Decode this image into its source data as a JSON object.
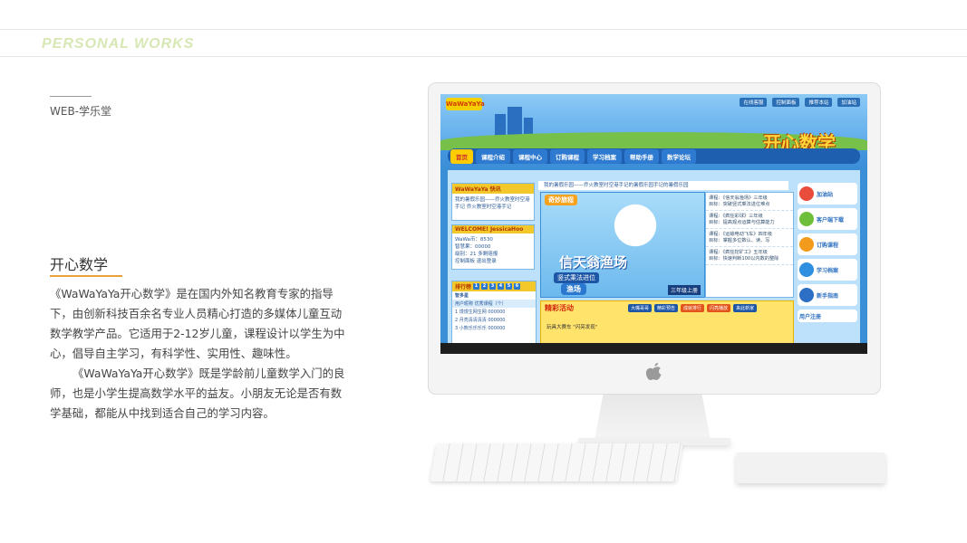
{
  "header": {
    "brand": "PERSONAL WORKS"
  },
  "section": {
    "label": "WEB-学乐堂"
  },
  "project": {
    "title": "开心数学",
    "paragraph1": "《WaWaYaYa开心数学》是在国内外知名教育专家的指导下，由创新科技百余名专业人员精心打造的多媒体儿童互动数学教学产品。它适用于2-12岁儿童，课程设计以学生为中心，倡导自主学习，有科学性、实用性、趣味性。",
    "paragraph2": "《WaWaYaYa开心数学》既是学龄前儿童数学入门的良师，也是小学生提高数学水平的益友。小朋友无论是否有数学基础，都能从中找到适合自己的学习内容。"
  },
  "screen": {
    "logo": "WaWaYaYa",
    "toplinks": [
      "在线客服",
      "控制面板",
      "推荐本站",
      "加油站"
    ],
    "site_title": "开心数学",
    "nav": [
      "首页",
      "课程介绍",
      "课程中心",
      "订购课程",
      "学习档案",
      "帮助手册",
      "数学论坛"
    ],
    "notice": "我的暑假乐园——乔火教室时空港手记的暑假乐园手记的暑假乐园",
    "news_head": "WaWaYaYa 快讯",
    "news_text": "我的暑假乐园——乔火教室时空港手记 乔火教室时空港手记",
    "welcome_head": "WELCOME! JessicaHoo",
    "welcome_lines": [
      "WaWa币：8530",
      "智慧果：00000",
      "级别：21 多剩赔报",
      "控制面板  退出登录"
    ],
    "feature_tag": "奇妙旅程",
    "feature_title": "信天翁渔场",
    "feature_sub": "竖式乘法进位",
    "feature_sub2": "渔场",
    "feature_badge": "三年级上册",
    "courses": [
      {
        "name": "课程：《信天翁渔场》三年级",
        "goal": "目标：突破竖式乘法进位难点"
      },
      {
        "name": "课程：《疯狂彩球》三年级",
        "goal": "目标：提高观点运算与估算能力"
      },
      {
        "name": "课程：《运输电动飞车》四年级",
        "goal": "目标：掌握多位数认、读、写"
      },
      {
        "name": "课程：《疯狂挖矿工》五年级",
        "goal": "目标：快速判断100以内数的整除"
      }
    ],
    "right_buttons": [
      "加油站",
      "客户端下载",
      "订购课程",
      "学习档案",
      "新手指南",
      "用户注册"
    ],
    "activity_title": "精彩活动",
    "activity_tabs": [
      "大嘴哥哥",
      "精彩预告",
      "成就排行",
      "闪亮播放",
      "来此新家"
    ],
    "activity_line": "玩具大赛车 \"闪亮发现\"",
    "rank_head": "排行榜",
    "rank_nums": [
      "1",
      "2",
      "3",
      "4",
      "5",
      "6"
    ],
    "rank_sub": "智多星",
    "rank_cols": "用户昵称    优秀课程（个）",
    "rank_rows": [
      "1 馒馒生网生网  000000",
      "2 月亮清清清清  000000",
      "3 小熊乐乐乐乐  000000"
    ]
  }
}
